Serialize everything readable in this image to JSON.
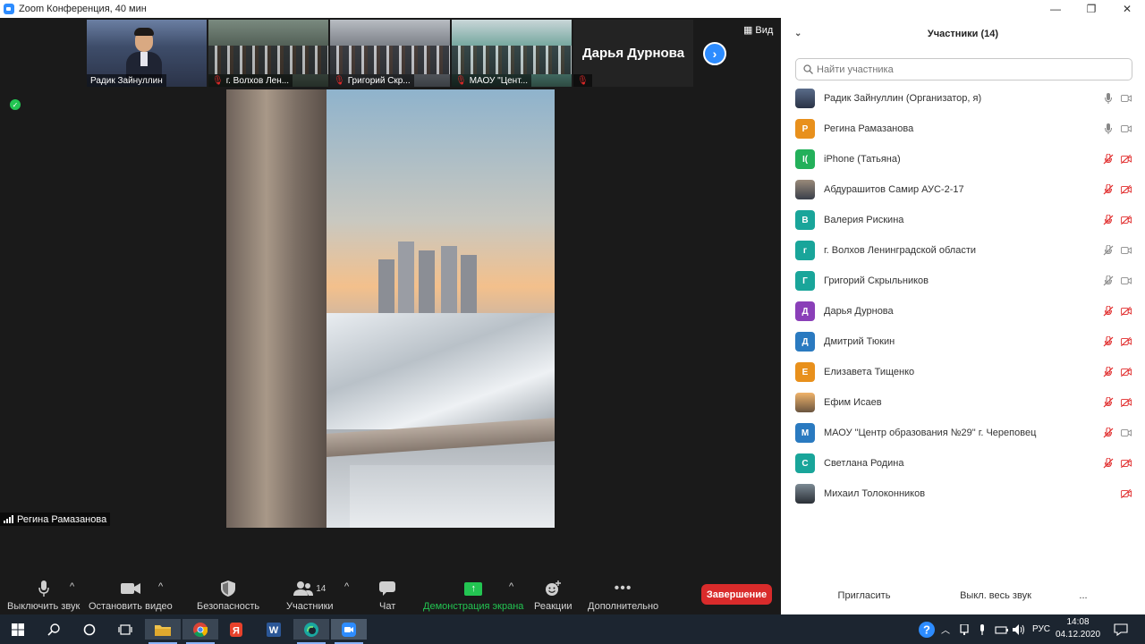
{
  "window": {
    "title": "Zoom Конференция, 40 мин",
    "minimize": "—",
    "maximize": "❐",
    "close": "✕"
  },
  "gallery": {
    "thumbs": [
      {
        "name": "Радик Зайнуллин",
        "muted": false
      },
      {
        "name": "г. Волхов Лен...",
        "muted": true
      },
      {
        "name": "Григорий Скр...",
        "muted": true
      },
      {
        "name": "МАОУ \"Цент...",
        "muted": true
      }
    ],
    "name_only_tile": "Дарья Дурнова",
    "view_label": "Вид"
  },
  "main_video": {
    "speaker_name": "Регина Рамазанова"
  },
  "toolbar": {
    "mute_label": "Выключить звук",
    "video_label": "Остановить видео",
    "security_label": "Безопасность",
    "participants_label": "Участники",
    "participants_count": "14",
    "chat_label": "Чат",
    "share_label": "Демонстрация экрана",
    "reactions_label": "Реакции",
    "more_label": "Дополнительно",
    "end_label": "Завершение"
  },
  "participants_panel": {
    "title": "Участники (14)",
    "search_placeholder": "Найти участника",
    "participants": [
      {
        "name": "Радик Зайнуллин (Организатор, я)",
        "avatar": "",
        "avatar_style": "photo-a",
        "avatar_color": "",
        "mic": "on",
        "cam": "on"
      },
      {
        "name": "Регина Рамазанова",
        "avatar": "Р",
        "avatar_style": "",
        "avatar_color": "#e8901c",
        "mic": "on",
        "cam": "on"
      },
      {
        "name": "iPhone (Татьяна)",
        "avatar": "I(",
        "avatar_style": "",
        "avatar_color": "#23b05a",
        "mic": "off",
        "cam": "off"
      },
      {
        "name": "Абдурашитов Самир АУС-2-17",
        "avatar": "",
        "avatar_style": "photo-b",
        "avatar_color": "",
        "mic": "off",
        "cam": "off"
      },
      {
        "name": "Валерия Рискина",
        "avatar": "В",
        "avatar_style": "",
        "avatar_color": "#19a59a",
        "mic": "off",
        "cam": "off"
      },
      {
        "name": "г. Волхов Ленинградской области",
        "avatar": "г",
        "avatar_style": "",
        "avatar_color": "#19a59a",
        "mic": "off-gray",
        "cam": "on"
      },
      {
        "name": "Григорий Скрыльников",
        "avatar": "Г",
        "avatar_style": "",
        "avatar_color": "#19a59a",
        "mic": "off-gray",
        "cam": "on"
      },
      {
        "name": "Дарья Дурнова",
        "avatar": "Д",
        "avatar_style": "",
        "avatar_color": "#8a3fb8",
        "mic": "off",
        "cam": "off"
      },
      {
        "name": "Дмитрий Тюкин",
        "avatar": "Д",
        "avatar_style": "",
        "avatar_color": "#2a7ac0",
        "mic": "off",
        "cam": "off"
      },
      {
        "name": "Елизавета Тищенко",
        "avatar": "Е",
        "avatar_style": "",
        "avatar_color": "#e8901c",
        "mic": "off",
        "cam": "off"
      },
      {
        "name": "Ефим Исаев",
        "avatar": "",
        "avatar_style": "photo-c",
        "avatar_color": "",
        "mic": "off",
        "cam": "off"
      },
      {
        "name": "МАОУ \"Центр образования №29\" г. Череповец",
        "avatar": "М",
        "avatar_style": "",
        "avatar_color": "#2a7ac0",
        "mic": "off",
        "cam": "on"
      },
      {
        "name": "Светлана Родина",
        "avatar": "С",
        "avatar_style": "",
        "avatar_color": "#19a59a",
        "mic": "off",
        "cam": "off"
      },
      {
        "name": "Михаил Толоконников",
        "avatar": "",
        "avatar_style": "photo-d",
        "avatar_color": "",
        "mic": "none",
        "cam": "off"
      }
    ],
    "invite_label": "Пригласить",
    "mute_all_label": "Выкл. весь звук",
    "more_label": "..."
  },
  "taskbar": {
    "language": "РУС",
    "time": "14:08",
    "date": "04.12.2020",
    "accent": "#8ab4f8"
  },
  "colors": {
    "zoom_blue": "#2d8cff",
    "end_red": "#d92b2b",
    "share_green": "#23c552",
    "muted_red": "#e02828"
  }
}
